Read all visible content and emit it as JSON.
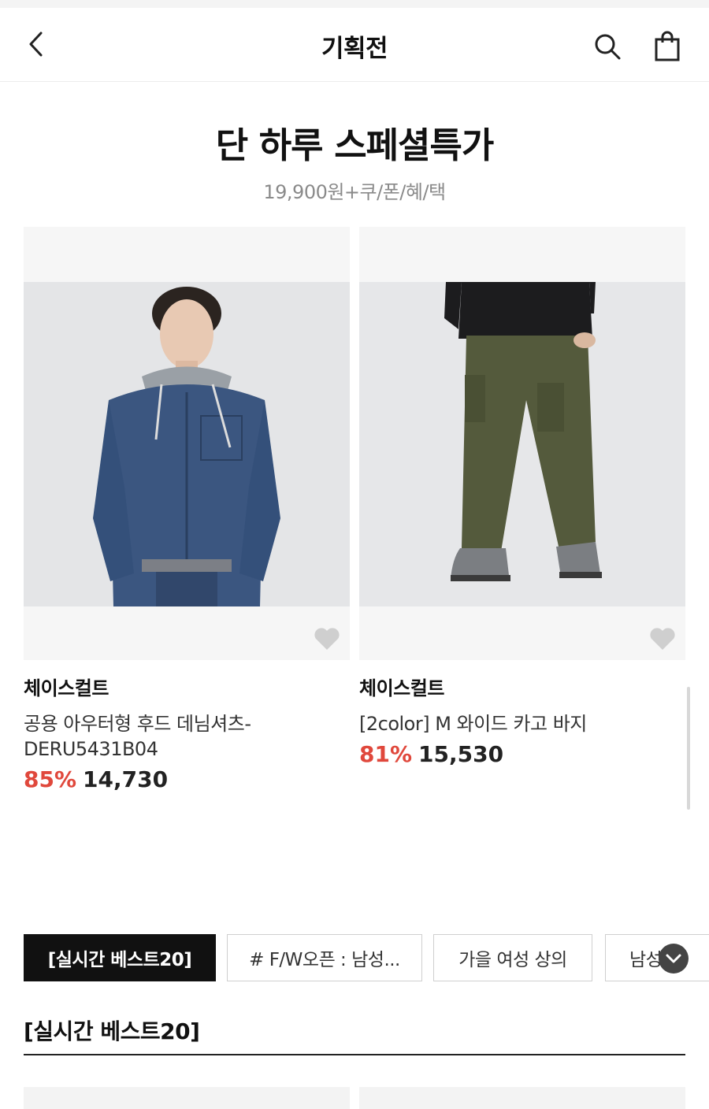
{
  "header": {
    "title": "기획전",
    "back_icon": "chevron-left-icon",
    "search_icon": "search-icon",
    "bag_icon": "shopping-bag-icon"
  },
  "event": {
    "title": "단 하루 스페셜특가",
    "subtitle": "19,900원+쿠/폰/혜/택"
  },
  "products": [
    {
      "brand": "체이스컬트",
      "name": "공용 아우터형 후드 데님셔츠-DERU5431B04",
      "discount": "85%",
      "price": "14,730"
    },
    {
      "brand": "체이스컬트",
      "name": "[2color] M 와이드 카고 바지",
      "discount": "81%",
      "price": "15,530"
    }
  ],
  "tabs": [
    {
      "label": "[실시간 베스트20]",
      "active": true
    },
    {
      "label": "# F/W오픈 : 남성...",
      "active": false
    },
    {
      "label": "가을 여성 상의",
      "active": false
    },
    {
      "label": "남성",
      "active": false
    }
  ],
  "section": {
    "title": "[실시간 베스트20]"
  },
  "colors": {
    "discount": "#e0483c",
    "active_tab": "#111111"
  }
}
